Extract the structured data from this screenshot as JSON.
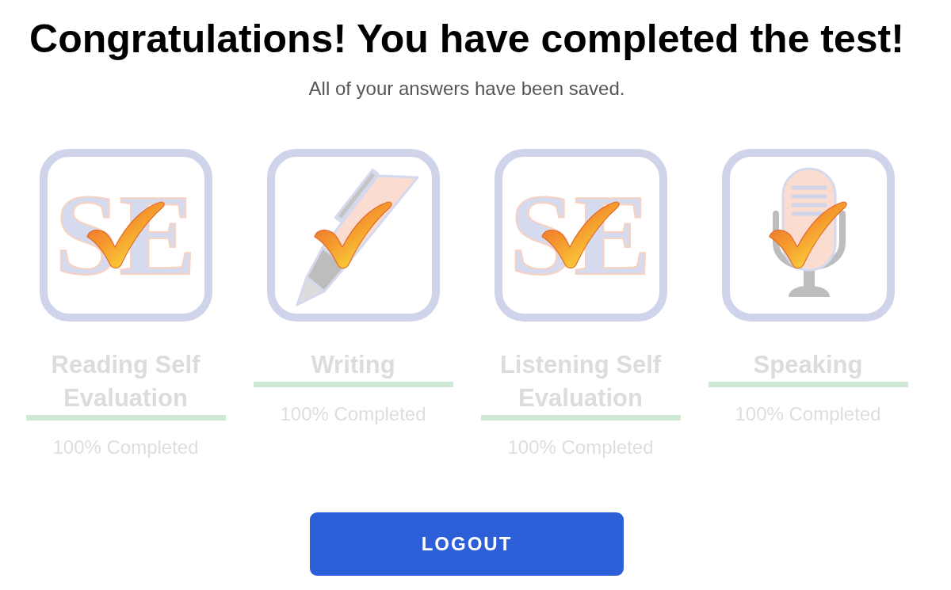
{
  "heading": "Congratulations! You have completed the test!",
  "subheading": "All of your answers have been saved.",
  "modules": [
    {
      "kind": "evaluation",
      "letters": "SE",
      "title": "Reading Self Evaluation",
      "level": 1,
      "status": "100% Completed"
    },
    {
      "kind": "writing",
      "title": "Writing",
      "level": 1,
      "status": "100% Completed"
    },
    {
      "kind": "evaluation",
      "letters": "SE",
      "title": "Listening Self Evaluation",
      "level": 1,
      "status": "100% Completed"
    },
    {
      "kind": "speaking",
      "title": "Speaking",
      "level": 1,
      "status": "100% Completed"
    }
  ],
  "logout_button": {
    "label": "LOGOUT"
  }
}
